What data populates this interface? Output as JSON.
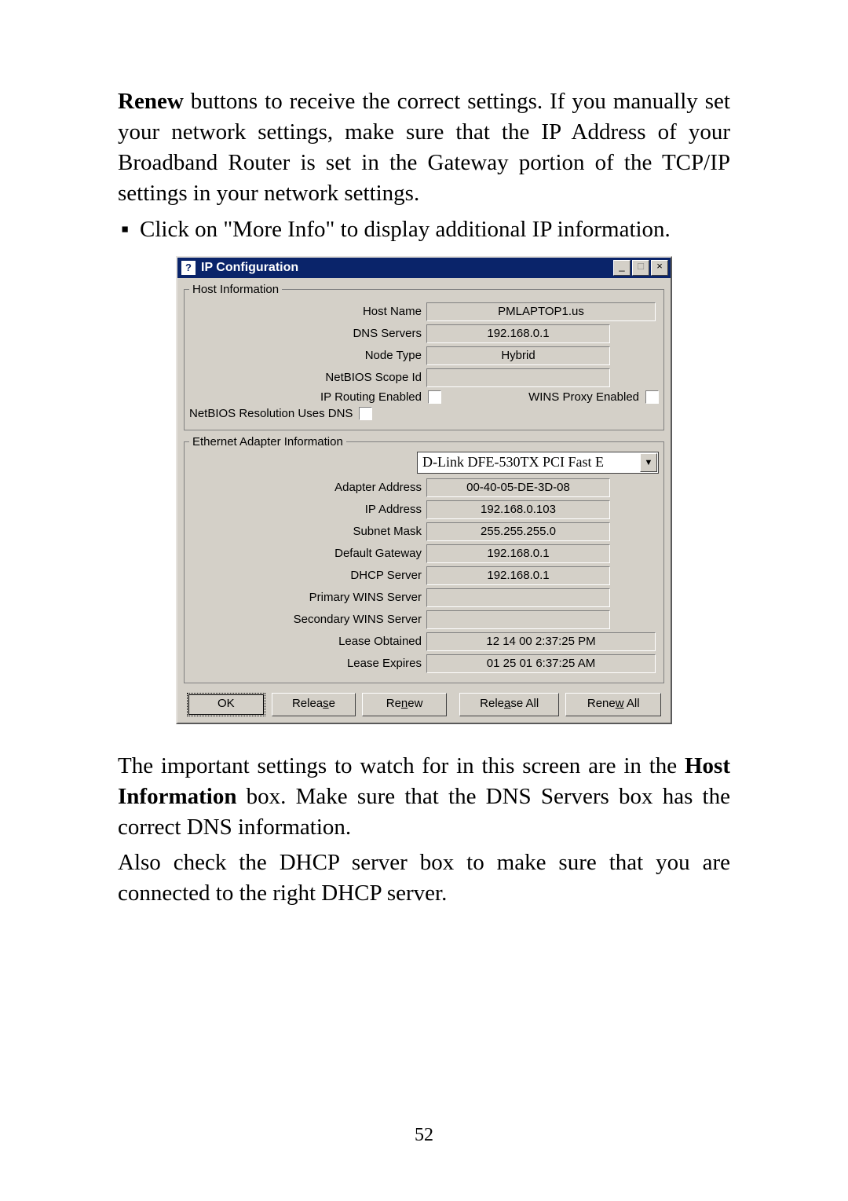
{
  "paragraph_top": {
    "renew": "Renew",
    "rest": " buttons to receive the correct settings. If you manually set your network settings, make sure that the IP Address of your Broadband Router is set in the Gateway portion of the TCP/IP settings in your network settings."
  },
  "bullet_text": "Click on \"More Info\" to display additional IP information.",
  "dialog": {
    "title": "IP Configuration",
    "win_min": "_",
    "win_max": "□",
    "win_close": "×",
    "group_host": "Host Information",
    "labels": {
      "host_name": "Host Name",
      "dns_servers": "DNS Servers",
      "node_type": "Node Type",
      "netbios_scope": "NetBIOS Scope Id",
      "ip_routing": "IP Routing Enabled",
      "wins_proxy": "WINS Proxy Enabled",
      "netbios_dns": "NetBIOS Resolution Uses DNS"
    },
    "values": {
      "host_name": "PMLAPTOP1.us",
      "dns_servers": "192.168.0.1",
      "node_type": "Hybrid",
      "netbios_scope": ""
    },
    "group_adapter": "Ethernet  Adapter Information",
    "adapter_selected": "D-Link DFE-530TX PCI Fast E",
    "adapter_labels": {
      "addr": "Adapter Address",
      "ip": "IP Address",
      "subnet": "Subnet Mask",
      "gateway": "Default Gateway",
      "dhcp": "DHCP Server",
      "pwins": "Primary WINS Server",
      "swins": "Secondary WINS Server",
      "lease_obt": "Lease Obtained",
      "lease_exp": "Lease Expires"
    },
    "adapter_values": {
      "addr": "00-40-05-DE-3D-08",
      "ip": "192.168.0.103",
      "subnet": "255.255.255.0",
      "gateway": "192.168.0.1",
      "dhcp": "192.168.0.1",
      "pwins": "",
      "swins": "",
      "lease_obt": "12 14 00 2:37:25 PM",
      "lease_exp": "01 25 01 6:37:25 AM"
    },
    "buttons": {
      "ok": "OK",
      "release_pre": "Relea",
      "release_u": "s",
      "release_post": "e",
      "renew_pre": "Re",
      "renew_u": "n",
      "renew_post": "ew",
      "release_all_pre": "Rele",
      "release_all_u": "a",
      "release_all_post": "se All",
      "renew_all_pre": "Rene",
      "renew_all_u": "w",
      "renew_all_post": " All"
    }
  },
  "paragraph_mid": {
    "p1a": "The important settings to watch for in this screen are in the ",
    "p1b": "Host Information",
    "p1c": " box. Make sure that the DNS Servers box has the correct DNS information."
  },
  "paragraph_bot": "Also check the DHCP server box to make sure that you are connected to the right DHCP server.",
  "page_number": "52"
}
